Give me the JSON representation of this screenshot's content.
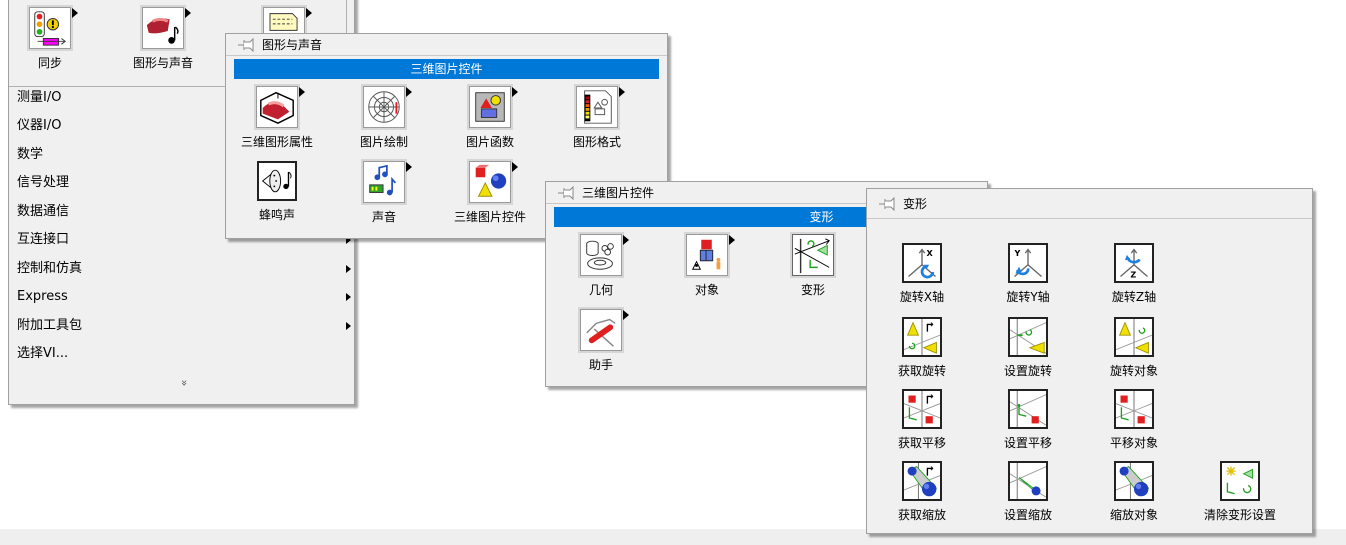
{
  "palette_main": {
    "top_cells": [
      {
        "label": "同步",
        "icon": "synchronization-icon"
      },
      {
        "label": "图形与声音",
        "icon": "graphics-sound-icon"
      },
      {
        "label": "",
        "icon": "report-generation-icon"
      }
    ],
    "menu_items": [
      {
        "label": "测量I/O",
        "has_submenu": false
      },
      {
        "label": "仪器I/O",
        "has_submenu": false
      },
      {
        "label": "数学",
        "has_submenu": false
      },
      {
        "label": "信号处理",
        "has_submenu": false
      },
      {
        "label": "数据通信",
        "has_submenu": false
      },
      {
        "label": "互连接口",
        "has_submenu": true
      },
      {
        "label": "控制和仿真",
        "has_submenu": true
      },
      {
        "label": "Express",
        "has_submenu": true
      },
      {
        "label": "附加工具包",
        "has_submenu": true
      },
      {
        "label": "选择VI...",
        "has_submenu": false
      }
    ],
    "expand_glyph": "»"
  },
  "palette_graphics": {
    "title": "图形与声音",
    "section": "三维图片控件",
    "items": [
      {
        "label": "三维图形属性",
        "icon": "3d-graph-properties-icon"
      },
      {
        "label": "图片绘制",
        "icon": "picture-plot-icon"
      },
      {
        "label": "图片函数",
        "icon": "picture-functions-icon"
      },
      {
        "label": "图形格式",
        "icon": "graphics-formats-icon"
      },
      {
        "label": "蜂鸣声",
        "icon": "beep-icon"
      },
      {
        "label": "声音",
        "icon": "sound-icon"
      },
      {
        "label": "三维图片控件",
        "icon": "3d-picture-control-icon"
      }
    ]
  },
  "palette_3d": {
    "title": "三维图片控件",
    "section": "变形",
    "items": [
      {
        "label": "几何",
        "icon": "geometries-icon"
      },
      {
        "label": "对象",
        "icon": "objects-icon"
      },
      {
        "label": "变形",
        "icon": "transformations-icon"
      },
      {
        "label": "助手",
        "icon": "helpers-icon"
      }
    ]
  },
  "palette_transform": {
    "title": "变形",
    "items": [
      {
        "label": "旋转X轴",
        "icon": "rotate-x-icon"
      },
      {
        "label": "旋转Y轴",
        "icon": "rotate-y-icon"
      },
      {
        "label": "旋转Z轴",
        "icon": "rotate-z-icon"
      },
      {
        "label": "获取旋转",
        "icon": "get-rotation-icon"
      },
      {
        "label": "设置旋转",
        "icon": "set-rotation-icon"
      },
      {
        "label": "旋转对象",
        "icon": "rotate-object-icon"
      },
      {
        "label": "获取平移",
        "icon": "get-translation-icon"
      },
      {
        "label": "设置平移",
        "icon": "set-translation-icon"
      },
      {
        "label": "平移对象",
        "icon": "translate-object-icon"
      },
      {
        "label": "获取缩放",
        "icon": "get-scale-icon"
      },
      {
        "label": "设置缩放",
        "icon": "set-scale-icon"
      },
      {
        "label": "缩放对象",
        "icon": "scale-object-icon"
      },
      {
        "label": "清除变形设置",
        "icon": "clear-transformations-icon"
      }
    ]
  },
  "colors": {
    "highlight": "#0078d7",
    "panel_bg": "#f0f0f0"
  }
}
